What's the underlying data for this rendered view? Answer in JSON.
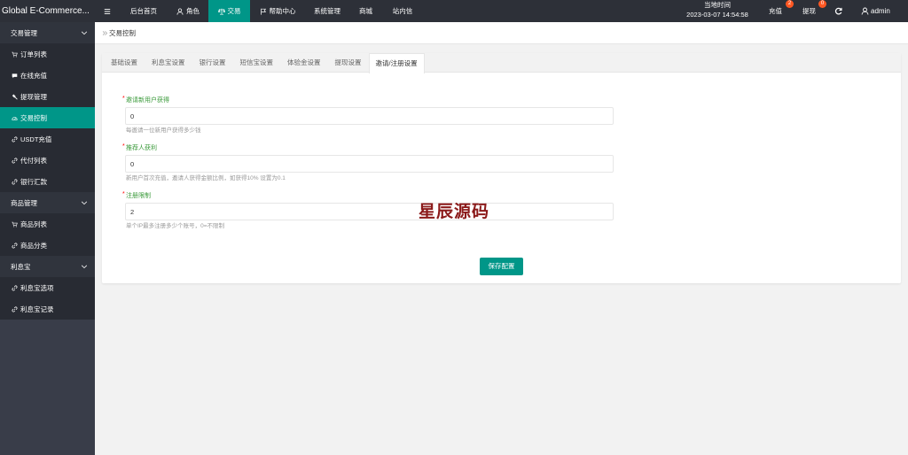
{
  "header": {
    "logo": "Global E-Commerce...",
    "toggle_icon": "menu-icon",
    "nav": [
      {
        "label": "后台首页",
        "icon": null,
        "active": false
      },
      {
        "label": "角色",
        "icon": "user-icon",
        "active": false
      },
      {
        "label": "交易",
        "icon": "scale-icon",
        "active": true
      },
      {
        "label": "帮助中心",
        "icon": "flag-icon",
        "active": false
      },
      {
        "label": "系统管理",
        "icon": null,
        "active": false
      },
      {
        "label": "商城",
        "icon": null,
        "active": false
      },
      {
        "label": "站内信",
        "icon": null,
        "active": false
      }
    ],
    "time_label": "当地时间",
    "time_value": "2023-03-07 14:54:58",
    "recharge": {
      "label": "充值",
      "badge": "2"
    },
    "withdraw": {
      "label": "提现",
      "badge": "0"
    },
    "refresh_icon": "refresh-icon",
    "user": {
      "name": "admin",
      "icon": "user-icon"
    }
  },
  "sidebar": {
    "groups": [
      {
        "label": "交易管理",
        "items": [
          {
            "label": "订单列表",
            "icon": "cart-icon",
            "active": false
          },
          {
            "label": "在线充值",
            "icon": "chat-icon",
            "active": false
          },
          {
            "label": "提现管理",
            "icon": "gavel-icon",
            "active": false
          },
          {
            "label": "交易控制",
            "icon": "dashboard-icon",
            "active": true
          },
          {
            "label": "USDT充值",
            "icon": "link-icon",
            "active": false
          },
          {
            "label": "代付列表",
            "icon": "link-icon",
            "active": false
          },
          {
            "label": "银行汇款",
            "icon": "link-icon",
            "active": false
          }
        ]
      },
      {
        "label": "商品管理",
        "items": [
          {
            "label": "商品列表",
            "icon": "cart-icon",
            "active": false
          },
          {
            "label": "商品分类",
            "icon": "link-icon",
            "active": false
          }
        ]
      },
      {
        "label": "利息宝",
        "items": [
          {
            "label": "利息宝选项",
            "icon": "link-icon",
            "active": false
          },
          {
            "label": "利息宝记录",
            "icon": "link-icon",
            "active": false
          }
        ]
      }
    ]
  },
  "breadcrumb": {
    "icon": "double-chevron-right-icon",
    "current": "交易控制"
  },
  "tabs": [
    {
      "label": "基础设置",
      "active": false
    },
    {
      "label": "利息宝设置",
      "active": false
    },
    {
      "label": "银行设置",
      "active": false
    },
    {
      "label": "短信宝设置",
      "active": false
    },
    {
      "label": "体验金设置",
      "active": false
    },
    {
      "label": "提现设置",
      "active": false
    },
    {
      "label": "邀请/注册设置",
      "active": true
    }
  ],
  "form": {
    "required_mark": "*",
    "fields": [
      {
        "label": "邀请新用户获得",
        "value": "0",
        "help": "每邀请一位新用户获得多少钱"
      },
      {
        "label": "推荐人获利",
        "value": "0",
        "help": "新用户首次充值，邀请人获得金额比例，如获得10% 设置为0.1"
      },
      {
        "label": "注册限制",
        "value": "2",
        "help": "单个IP最多注册多少个账号，0=不限制"
      }
    ],
    "submit_label": "保存配置"
  },
  "watermark": "星辰源码",
  "colors": {
    "accent": "#009688",
    "badge": "#ff5722",
    "label": "#3a9a3a",
    "required": "#ff0000",
    "watermark": "#8b1a1a",
    "header_bg": "#2d3038",
    "sidebar_bg": "#393d49"
  }
}
